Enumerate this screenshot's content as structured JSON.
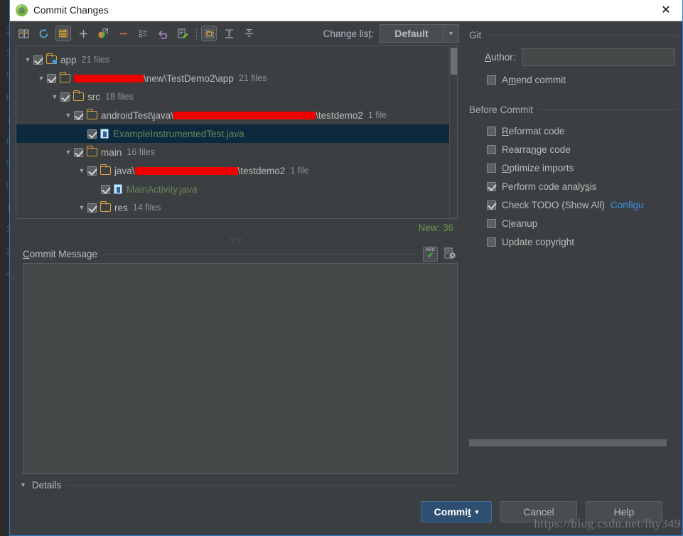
{
  "window": {
    "title": "Commit Changes",
    "app_icon": "android-icon",
    "close_label": "✕"
  },
  "toolbar": {
    "icons": [
      {
        "name": "show-diff-icon",
        "glyph": "diff"
      },
      {
        "name": "refresh-icon",
        "glyph": "refresh"
      },
      {
        "name": "group-by-icon",
        "glyph": "grouping",
        "framed": true
      },
      {
        "name": "add-icon",
        "glyph": "plus"
      },
      {
        "name": "move-to-changelist-icon",
        "glyph": "move"
      },
      {
        "name": "delete-icon",
        "glyph": "minus"
      },
      {
        "name": "show-flatten-icon",
        "glyph": "flatten"
      },
      {
        "name": "revert-icon",
        "glyph": "revert"
      },
      {
        "name": "edit-source-icon",
        "glyph": "edit"
      },
      {
        "name": "group-by-directory-icon",
        "glyph": "directory",
        "framed": true
      },
      {
        "name": "expand-all-icon",
        "glyph": "expand"
      },
      {
        "name": "collapse-all-icon",
        "glyph": "collapse"
      }
    ],
    "changelist_label_pre": "Change lis",
    "changelist_label_mnemonic": "t",
    "changelist_label_post": ":",
    "changelist_value": "Default",
    "changelist_arrow": "▼"
  },
  "tree": {
    "rows": [
      {
        "indent": 0,
        "twisty": "▼",
        "checked": true,
        "icon": "module-folder",
        "label": "app",
        "count": "21 files",
        "selected": false,
        "redactions": []
      },
      {
        "indent": 1,
        "twisty": "▼",
        "checked": true,
        "icon": "folder",
        "label_pre": "",
        "label": "\\new\\TestDemo2\\app",
        "count": "21 files",
        "selected": false,
        "redact_before_width": 98
      },
      {
        "indent": 2,
        "twisty": "▼",
        "checked": true,
        "icon": "folder",
        "label": "src",
        "count": "18 files",
        "selected": false
      },
      {
        "indent": 3,
        "twisty": "▼",
        "checked": true,
        "icon": "folder",
        "label": "androidTest\\java\\",
        "label_tail": "\\testdemo2",
        "count": "1 file",
        "selected": false,
        "redact_mid_width": 200
      },
      {
        "indent": 4,
        "twisty": "",
        "checked": true,
        "icon": "file",
        "label": "ExampleInstrumentedTest.java",
        "count": "",
        "selected": true,
        "green": true
      },
      {
        "indent": 3,
        "twisty": "▼",
        "checked": true,
        "icon": "folder",
        "label": "main",
        "count": "16 files",
        "selected": false
      },
      {
        "indent": 4,
        "twisty": "▼",
        "checked": true,
        "icon": "folder",
        "label": "java\\",
        "label_tail": "\\testdemo2",
        "count": "1 file",
        "selected": false,
        "redact_mid_width": 145
      },
      {
        "indent": 5,
        "twisty": "",
        "checked": true,
        "icon": "file",
        "label": "MainActivity.java",
        "count": "",
        "selected": false,
        "green": true
      },
      {
        "indent": 4,
        "twisty": "▼",
        "checked": true,
        "icon": "folder",
        "label": "res",
        "count": "14 files",
        "selected": false
      }
    ]
  },
  "summary": {
    "new_label": "New: 36"
  },
  "commit_message": {
    "title_mnemonic": "C",
    "title_rest": "ommit Message",
    "value": "",
    "placeholder": "",
    "spellcheck_icon": "abc-spellcheck-icon",
    "spellcheck_text": "ABC",
    "spellcheck_tick": "✔",
    "history_icon": "message-history-icon"
  },
  "details": {
    "caret": "▼",
    "label": "Details"
  },
  "git": {
    "group_title": "Git",
    "author_label_mnemonic": "A",
    "author_label_rest": "uthor:",
    "author_value": "",
    "amend": {
      "checked": false,
      "label_pre": "A",
      "label_mnemonic": "m",
      "label_post": "end commit"
    }
  },
  "before_commit": {
    "group_title": "Before Commit",
    "options": [
      {
        "name": "reformat-code",
        "checked": false,
        "pre": "",
        "mnemonic": "R",
        "post": "eformat code"
      },
      {
        "name": "rearrange-code",
        "checked": false,
        "pre": "Rearra",
        "mnemonic": "n",
        "post": "ge code"
      },
      {
        "name": "optimize-imports",
        "checked": false,
        "pre": "",
        "mnemonic": "O",
        "post": "ptimize imports"
      },
      {
        "name": "perform-code-analysis",
        "checked": true,
        "pre": "Perform code analy",
        "mnemonic": "s",
        "post": "is"
      },
      {
        "name": "check-todo",
        "checked": true,
        "pre": "Check TODO (Show All)",
        "mnemonic": "",
        "post": "",
        "link": "Configu"
      },
      {
        "name": "cleanup",
        "checked": false,
        "pre": "C",
        "mnemonic": "l",
        "post": "eanup"
      },
      {
        "name": "update-copyright",
        "checked": false,
        "pre": "Update copyright",
        "mnemonic": "",
        "post": ""
      }
    ]
  },
  "footer": {
    "commit_pre": "Commi",
    "commit_mnemonic": "t",
    "commit_caret": "▾",
    "cancel_label": "Cancel",
    "help_label": "Help"
  },
  "watermark": {
    "text": "https://blog.csdn.net/lhy349"
  },
  "backdrop": {
    "gutter": [
      "2",
      "3",
      "5",
      "6",
      "7",
      "8",
      "9",
      "0",
      "1",
      "2",
      "3",
      "4"
    ]
  },
  "colors": {
    "dialog_bg": "#3c3f41",
    "accent_border": "#2d7cd6",
    "text": "#bbbbbb",
    "green_file": "#6a8759",
    "green_new": "#6a9a52",
    "link": "#3b8ee0",
    "primary_button": "#2e4f72",
    "redaction": "#ee0000",
    "selection": "#0d293e"
  }
}
